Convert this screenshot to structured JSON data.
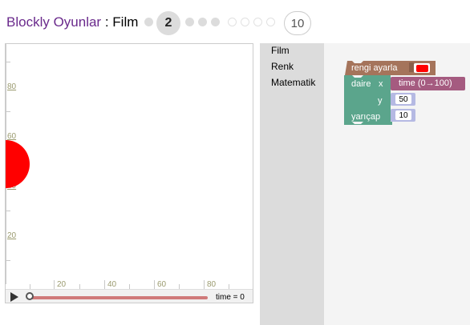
{
  "header": {
    "app_name": "Blockly Oyunlar",
    "separator": " : ",
    "page_name": "Film",
    "current_level": "2",
    "last_level": "10"
  },
  "level_progress": {
    "completed": 5,
    "upcoming": 3
  },
  "visualization": {
    "y_ticks": [
      "80",
      "60",
      "40",
      "20"
    ],
    "x_ticks": [
      "20",
      "40",
      "60",
      "80"
    ],
    "time_label": "time = 0",
    "circle_color": "#ff0000"
  },
  "toolbox": {
    "items": [
      "Film",
      "Renk",
      "Matematik"
    ]
  },
  "workspace": {
    "set_color_block": {
      "label": "rengi ayarla",
      "color_value": "#ff0000",
      "block_color": "#a5745b"
    },
    "circle_block": {
      "label": "daire",
      "x_label": "x",
      "y_label": "y",
      "radius_label": "yarıçap",
      "block_color": "#5ba58c",
      "x_value": "time (0→100)",
      "x_value_color": "#a55b80",
      "y_value": "50",
      "radius_value": "10",
      "number_block_color": "#b5b9e3"
    }
  }
}
